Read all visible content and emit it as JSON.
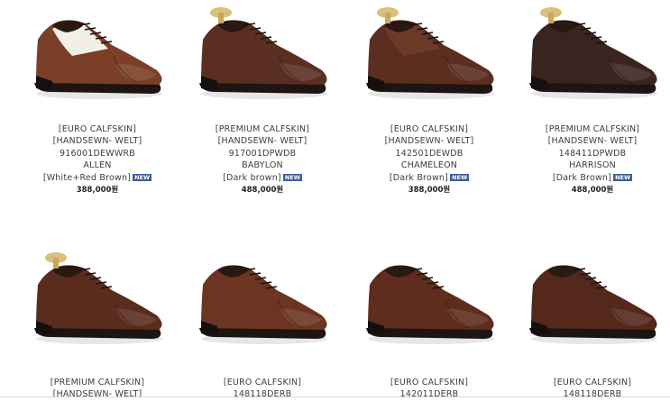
{
  "products": [
    {
      "line1": "[EURO CALFSKIN]",
      "line2": "[HANDSEWN- WELT]",
      "code": "916001DEWWRB",
      "name": "ALLEN",
      "color": "[White+Red Brown]",
      "badge": "NEW",
      "price": "388,000원",
      "shoe_color": "#7a3f26",
      "accent_color": "#f2efe8",
      "tree": false
    },
    {
      "line1": "[PREMIUM CALFSKIN]",
      "line2": "[HANDSEWN- WELT]",
      "code": "917001DPWDB",
      "name": "BABYLON",
      "color": "[Dark brown]",
      "badge": "NEW",
      "price": "488,000원",
      "shoe_color": "#5a2f22",
      "accent_color": "#5a2f22",
      "tree": true
    },
    {
      "line1": "[EURO CALFSKIN]",
      "line2": "[HANDSEWN- WELT]",
      "code": "142501DEWDB",
      "name": "CHAMELEON",
      "color": "[Dark Brown]",
      "badge": "NEW",
      "price": "388,000원",
      "shoe_color": "#5b2e20",
      "accent_color": "#6e3a28",
      "tree": true
    },
    {
      "line1": "[PREMIUM CALFSKIN]",
      "line2": "[HANDSEWN- WELT]",
      "code": "148411DPWDB",
      "name": "HARRISON",
      "color": "[Dark Brown]",
      "badge": "NEW",
      "price": "488,000원",
      "shoe_color": "#3a2420",
      "accent_color": "#3a2420",
      "tree": true
    },
    {
      "line1": "[PREMIUM CALFSKIN]",
      "line2": "[HANDSEWN- WELT]",
      "code": "",
      "name": "",
      "color": "",
      "badge": "",
      "price": "",
      "shoe_color": "#5a2c1e",
      "accent_color": "#5a2c1e",
      "tree": true
    },
    {
      "line1": "[EURO CALFSKIN]",
      "line2": "148118DERB",
      "code": "",
      "name": "",
      "color": "",
      "badge": "",
      "price": "",
      "shoe_color": "#6b3522",
      "accent_color": "#6b3522",
      "tree": false
    },
    {
      "line1": "[EURO CALFSKIN]",
      "line2": "142011DERB",
      "code": "",
      "name": "",
      "color": "",
      "badge": "",
      "price": "",
      "shoe_color": "#5e2d1d",
      "accent_color": "#5e2d1d",
      "tree": false
    },
    {
      "line1": "[EURO CALFSKIN]",
      "line2": "148118DERB",
      "code": "",
      "name": "",
      "color": "",
      "badge": "",
      "price": "",
      "shoe_color": "#55281c",
      "accent_color": "#55281c",
      "tree": false
    }
  ]
}
